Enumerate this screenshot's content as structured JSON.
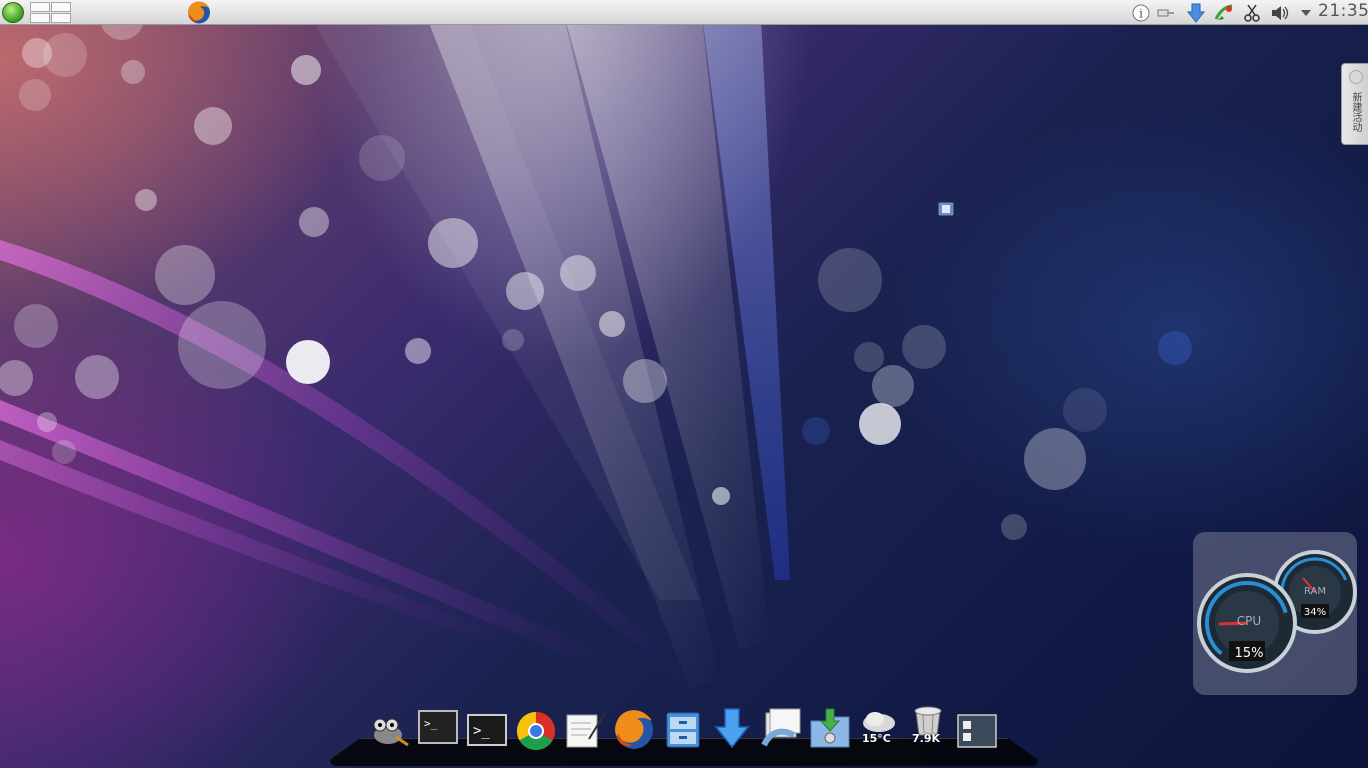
{
  "top_panel": {
    "launcher_icon": "kde-menu-icon",
    "pager_icon": "virtual-desktop-pager-icon",
    "task_icons": [
      "firefox-icon"
    ],
    "tray_icons": [
      "info-icon",
      "network-icon",
      "download-icon",
      "update-manager-icon",
      "clipboard-scissors-icon",
      "volume-icon",
      "tray-expand-arrow-icon"
    ],
    "clock": "21:35"
  },
  "activity_tab": {
    "label": "新建活动"
  },
  "desktop": {
    "icons": [
      "file-icon"
    ]
  },
  "gauges": {
    "cpu": {
      "label": "CPU",
      "value": "15%"
    },
    "ram": {
      "label": "RAM",
      "value": "34%"
    }
  },
  "dock": {
    "items": [
      {
        "name": "gimp-icon"
      },
      {
        "name": "terminal-icon"
      },
      {
        "name": "terminal-2-icon"
      },
      {
        "name": "chrome-icon"
      },
      {
        "name": "text-editor-icon"
      },
      {
        "name": "firefox-icon"
      },
      {
        "name": "file-cabinet-icon"
      },
      {
        "name": "download-arrow-icon"
      },
      {
        "name": "file-manager-icon"
      },
      {
        "name": "downloads-folder-icon"
      },
      {
        "name": "weather-icon",
        "label": "15°C"
      },
      {
        "name": "trash-icon",
        "label": "7.9K"
      },
      {
        "name": "show-desktop-icon"
      }
    ]
  },
  "colors": {
    "panel": "#e4e4e4",
    "clock": "#555555",
    "accent": "#2a6bd6"
  }
}
